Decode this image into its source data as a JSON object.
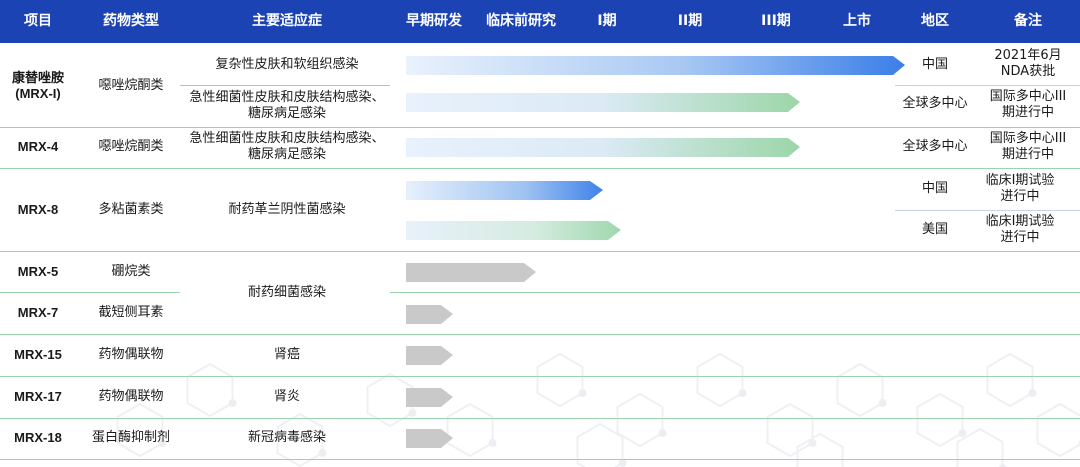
{
  "header": {
    "project": "项目",
    "drug_class": "药物类型",
    "indication": "主要适应症",
    "early_research": "早期研发",
    "preclinical": "临床前研究",
    "phase1": "I期",
    "phase2": "II期",
    "phase3": "III期",
    "marketed": "上市",
    "region": "地区",
    "remark": "备注"
  },
  "rows": [
    {
      "name_line1": "康替唑胺",
      "name_line2": "(MRX-I)",
      "drug_class": "噁唑烷酮类",
      "indications": [
        "复杂性皮肤和软组织感染",
        "急性细菌性皮肤和皮肤结构感染、",
        "糖尿病足感染"
      ],
      "regions": [
        "中国",
        "全球多中心"
      ],
      "remarks": [
        "2021年6月",
        "NDA获批",
        "国际多中心III",
        "期进行中"
      ]
    },
    {
      "name": "MRX-4",
      "drug_class": "噁唑烷酮类",
      "indications": [
        "急性细菌性皮肤和皮肤结构感染、",
        "糖尿病足感染"
      ],
      "region": "全球多中心",
      "remarks": [
        "国际多中心III",
        "期进行中"
      ]
    },
    {
      "name": "MRX-8",
      "drug_class": "多粘菌素类",
      "indication": "耐药革兰阴性菌感染",
      "regions": [
        "中国",
        "美国"
      ],
      "remarks": [
        "临床I期试验",
        "进行中",
        "临床I期试验",
        "进行中"
      ]
    },
    {
      "name": "MRX-5",
      "drug_class": "硼烷类"
    },
    {
      "name": "MRX-7",
      "drug_class": "截短侧耳素"
    },
    {
      "name": "MRX-15",
      "drug_class": "药物偶联物",
      "indication": "肾癌"
    },
    {
      "name": "MRX-17",
      "drug_class": "药物偶联物",
      "indication": "肾炎"
    },
    {
      "name": "MRX-18",
      "drug_class": "蛋白酶抑制剂",
      "indication": "新冠病毒感染"
    }
  ],
  "shared_indication_mrx5_mrx7": "耐药细菌感染",
  "pipeline_progress": [
    {
      "program": "康替唑胺 (MRX-I)",
      "indication": "复杂性皮肤和软组织感染",
      "region": "中国",
      "stage": "上市"
    },
    {
      "program": "康替唑胺 (MRX-I)",
      "indication": "急性细菌性皮肤和皮肤结构感染、糖尿病足感染",
      "region": "全球多中心",
      "stage": "III期"
    },
    {
      "program": "MRX-4",
      "indication": "急性细菌性皮肤和皮肤结构感染、糖尿病足感染",
      "region": "全球多中心",
      "stage": "III期"
    },
    {
      "program": "MRX-8",
      "region": "中国",
      "stage": "I期"
    },
    {
      "program": "MRX-8",
      "region": "美国",
      "stage": "I期"
    },
    {
      "program": "MRX-5",
      "stage": "临床前研究"
    },
    {
      "program": "MRX-7",
      "stage": "早期研发"
    },
    {
      "program": "MRX-15",
      "stage": "早期研发"
    },
    {
      "program": "MRX-17",
      "stage": "早期研发"
    },
    {
      "program": "MRX-18",
      "stage": "早期研发"
    }
  ],
  "colors": {
    "header_bg": "#1b43b4",
    "header_text": "#ffffff",
    "bar_blue": "#3a7ee8",
    "bar_green": "#8fcf9f",
    "bar_gray": "#c9c9c9",
    "divider_green": "#9cd3ad"
  }
}
